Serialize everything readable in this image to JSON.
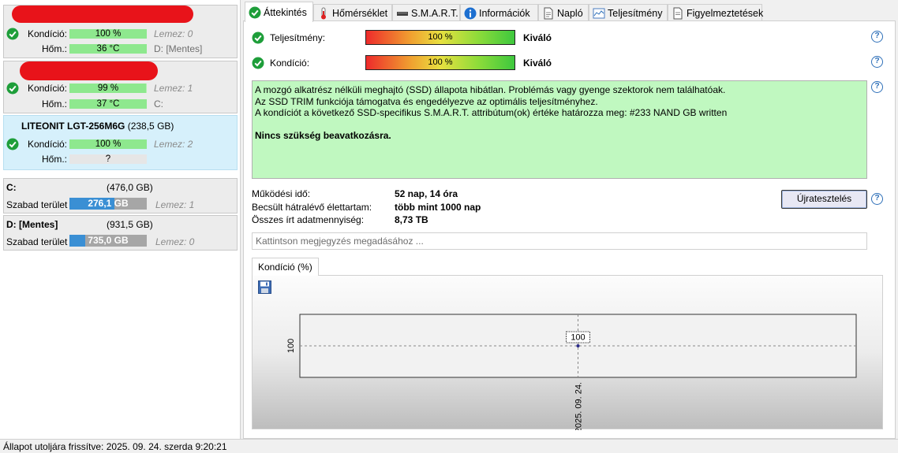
{
  "disks": [
    {
      "title": "",
      "redacted": true,
      "condition_label": "Kondíció:",
      "condition_value": "100 %",
      "condition_fraction": 1.0,
      "temp_label": "Hőm.:",
      "temp_value": "36 °C",
      "disk_label": "Lemez: 0",
      "drive_label": "D: [Mentes]"
    },
    {
      "title": "",
      "redacted": true,
      "condition_label": "Kondíció:",
      "condition_value": "99 %",
      "condition_fraction": 0.99,
      "temp_label": "Hőm.:",
      "temp_value": "37 °C",
      "disk_label": "Lemez: 1",
      "drive_label": "C:"
    },
    {
      "title": "LITEONIT LGT-256M6G",
      "title_size": "(238,5 GB)",
      "condition_label": "Kondíció:",
      "condition_value": "100 %",
      "condition_fraction": 1.0,
      "temp_label": "Hőm.:",
      "temp_value": "?",
      "disk_label": "Lemez: 2"
    }
  ],
  "volumes": [
    {
      "name": "C:",
      "size": "(476,0 GB)",
      "free_label": "Szabad terület",
      "free_value": "276,1 GB",
      "free_fraction": 0.58,
      "disk_label": "Lemez: 1"
    },
    {
      "name": "D: [Mentes]",
      "size": "(931,5 GB)",
      "free_label": "Szabad terület",
      "free_value": "735,0 GB",
      "free_fraction": 0.2,
      "disk_label": "Lemez: 0"
    }
  ],
  "tabs": [
    {
      "label": "Áttekintés",
      "icon": "check-circle-icon",
      "active": true
    },
    {
      "label": "Hőmérséklet",
      "icon": "thermometer-icon"
    },
    {
      "label": "S.M.A.R.T.",
      "icon": "drive-icon"
    },
    {
      "label": "Információk",
      "icon": "info-icon"
    },
    {
      "label": "Napló",
      "icon": "document-icon"
    },
    {
      "label": "Teljesítmény",
      "icon": "performance-chart-icon"
    },
    {
      "label": "Figyelmeztetések",
      "icon": "alerts-icon"
    }
  ],
  "overview": {
    "performance_label": "Teljesítmény:",
    "performance_value": "100 %",
    "performance_fraction": 1.0,
    "performance_rating": "Kiváló",
    "condition_label": "Kondíció:",
    "condition_value": "100 %",
    "condition_fraction": 1.0,
    "condition_rating": "Kiváló",
    "info_lines": [
      "A mozgó alkatrész nélküli meghajtó (SSD) állapota hibátlan. Problémás vagy gyenge szektorok nem találhatóak.",
      "Az SSD TRIM funkciója támogatva és engedélyezve az optimális teljesítményhez.",
      "A kondíciót a következő SSD-specifikus S.M.A.R.T. attribútum(ok) értéke határozza meg:  #233 NAND GB written"
    ],
    "info_action": "Nincs szükség beavatkozásra.",
    "uptime_label": "Működési idő:",
    "uptime_value": "52 nap, 14 óra",
    "lifetime_label": "Becsült hátralévő élettartam:",
    "lifetime_value": "több mint 1000 nap",
    "written_label": "Összes írt adatmennyiség:",
    "written_value": "8,73 TB",
    "retest_button": "Újratesztelés",
    "note_placeholder": "Kattintson megjegyzés megadásához ...",
    "help_glyph": "?"
  },
  "chart_tab_label": "Kondíció  (%)",
  "chart_data": {
    "type": "line",
    "x": [
      "2025. 09. 24."
    ],
    "series": [
      {
        "values": [
          100
        ]
      }
    ],
    "xlabel": "",
    "ylabel": "",
    "y_tick_labels": [
      "100"
    ],
    "x_tick_labels": [
      "2025. 09. 24."
    ],
    "data_labels": [
      "100"
    ],
    "grid": true
  },
  "status_text": "Állapot utoljára frissítve: 2025. 09. 24. szerda 9:20:21",
  "colors": {
    "condition_bar": "#8ee88e",
    "info_bg": "#c0f8c0",
    "selected_card": "#d6f0fb",
    "volume_used": "#3a8fd4",
    "check_green": "#1e9e3a",
    "help_blue": "#2d6fb8"
  }
}
